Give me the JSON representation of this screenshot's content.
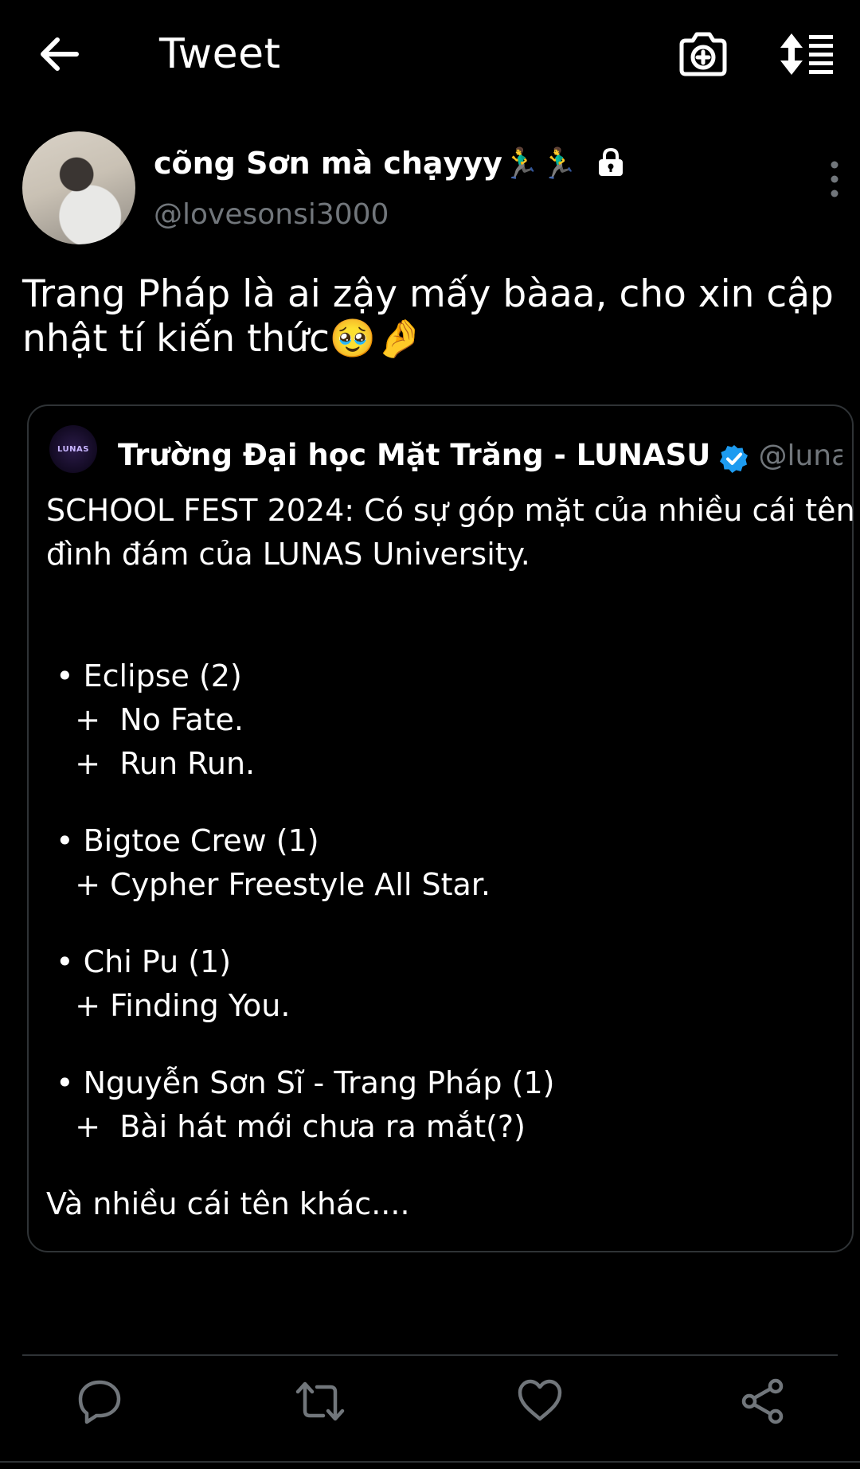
{
  "topbar": {
    "title": "Tweet"
  },
  "author": {
    "display_name": "cõng Sơn mà chạyyy🏃‍♂️🏃‍♂️",
    "handle": "@lovesonsi3000"
  },
  "tweet": {
    "text_lines": [
      "Trang Pháp là ai zậy mấy bàaa, cho xin cập",
      "nhật tí kiến thức🥹🤌"
    ]
  },
  "quote": {
    "avatar_text": "LUNAS",
    "name": "Trường Đại học Mặt Trăng - LUNASU",
    "handle": "@lunasu...",
    "intro_lines": [
      "SCHOOL FEST 2024: Có sự góp mặt của nhiều cái tên",
      "đình đám của LUNAS University."
    ],
    "groups": [
      {
        "title": " • Eclipse (2)",
        "items": [
          "   +  No Fate.",
          "   +  Run Run."
        ]
      },
      {
        "title": " • Bigtoe Crew (1)",
        "items": [
          "   + Cypher Freestyle All Star."
        ]
      },
      {
        "title": " • Chi Pu (1)",
        "items": [
          "   + Finding You."
        ]
      },
      {
        "title": " • Nguyễn Sơn Sĩ - Trang Pháp (1)",
        "items": [
          "   +  Bài hát mới chưa ra mắt(?)"
        ]
      }
    ],
    "outro": "Và nhiều cái tên khác...."
  },
  "colors": {
    "background": "#000000",
    "text": "#ffffff",
    "secondary_text": "#71767b",
    "border": "#2f3336",
    "verified": "#1d9bf0"
  },
  "icons": [
    "back-arrow-icon",
    "camera-plus-icon",
    "sort-icon",
    "lock-icon",
    "more-vertical-icon",
    "verified-badge-icon",
    "reply-icon",
    "retweet-icon",
    "like-icon",
    "share-icon"
  ]
}
